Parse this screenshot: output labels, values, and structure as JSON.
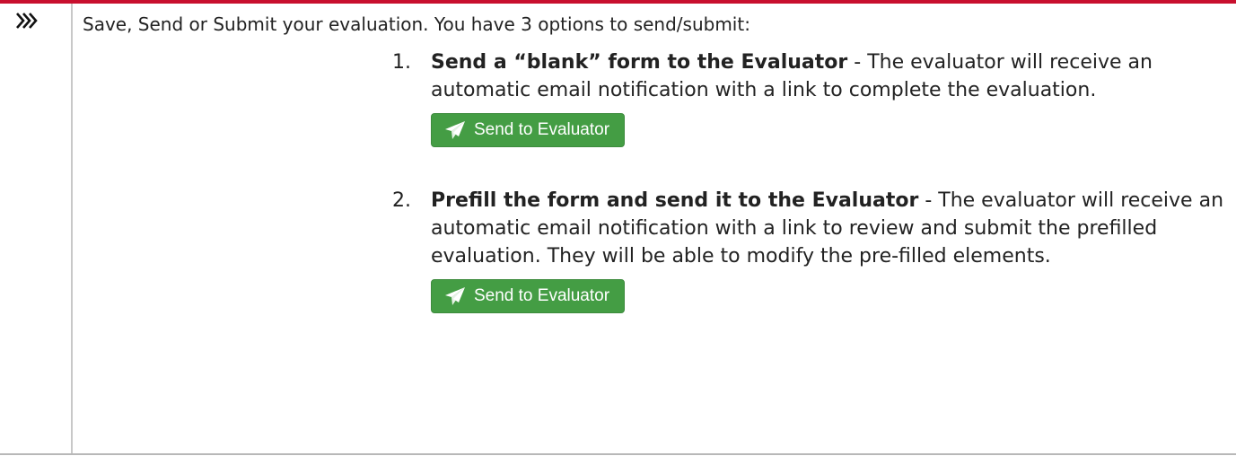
{
  "intro": {
    "text": "Save, Send or Submit your evaluation. You have 3 options to send/submit:"
  },
  "steps": [
    {
      "number": "1.",
      "title": "Send a “blank” form to the Evaluator",
      "description": " - The evaluator will receive an automatic email notification with a link to complete the evaluation.",
      "button_label": "Send to Evaluator"
    },
    {
      "number": "2.",
      "title": "Prefill the form and send it to the Evaluator",
      "description": " - The evaluator will receive an automatic email notification with a link to review and submit the prefilled evaluation. They will be able to modify the pre-filled elements.",
      "button_label": "Send to Evaluator"
    }
  ],
  "icons": {
    "marker": "triple-chevron-right-icon",
    "button": "paper-plane-icon"
  },
  "colors": {
    "top_rule": "#c8102e",
    "button_bg": "#449d44",
    "button_text": "#ffffff"
  }
}
